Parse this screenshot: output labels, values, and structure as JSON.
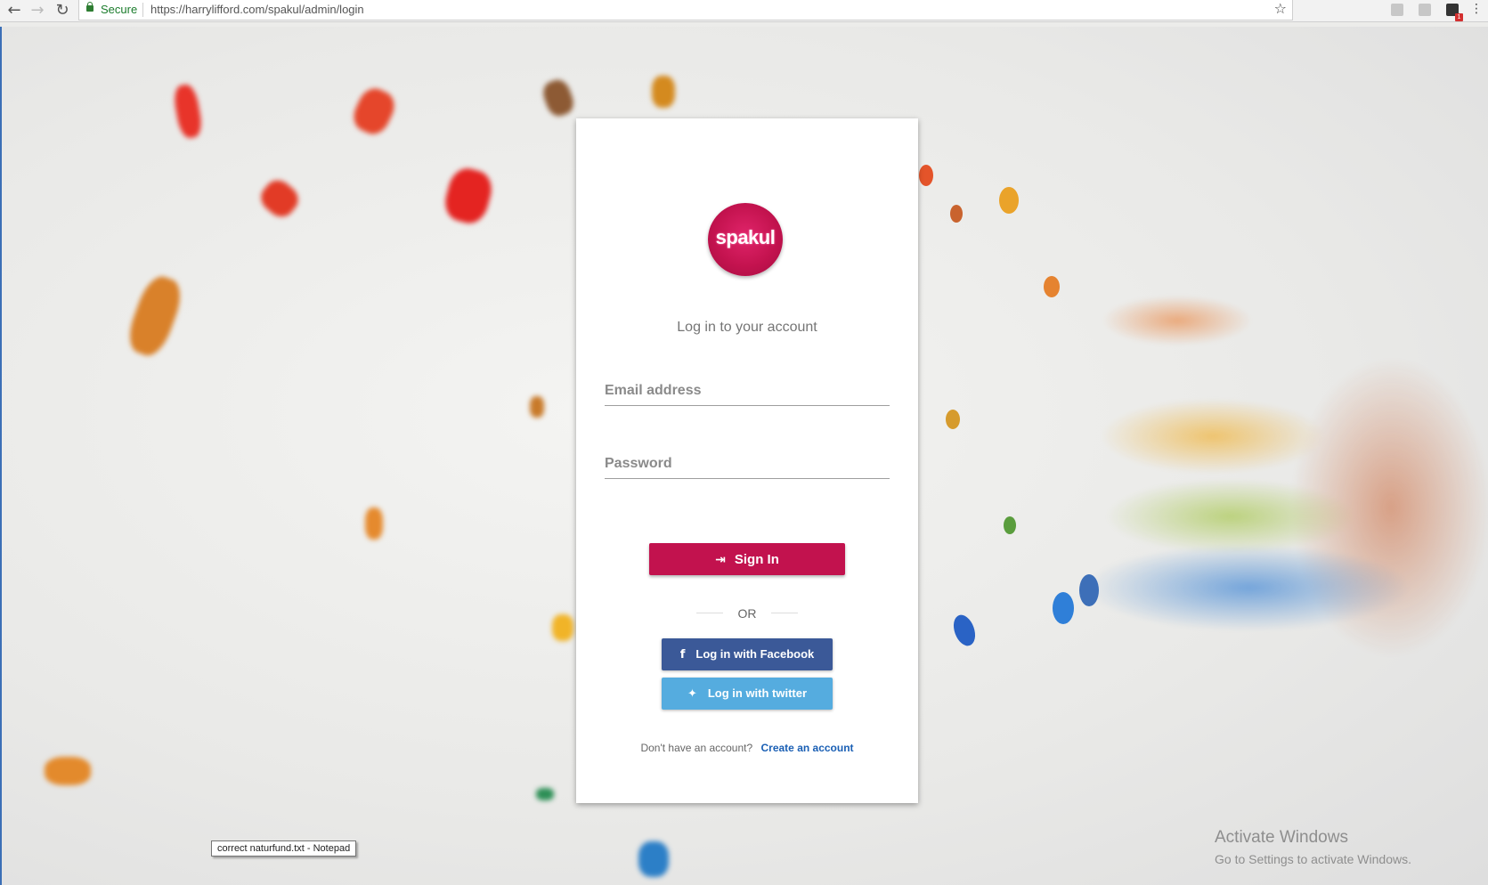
{
  "browser": {
    "secure_label": "Secure",
    "url": "https://harrylifford.com/spakul/admin/login",
    "extension_badge": "1"
  },
  "login": {
    "logo_text": "spakul",
    "subtitle": "Log in to your account",
    "email_placeholder": "Email address",
    "password_placeholder": "Password",
    "signin_label": "Sign In",
    "or_label": "OR",
    "facebook_label": "Log in with Facebook",
    "twitter_label": "Log in with twitter",
    "signup_prompt": "Don't have an account?",
    "signup_link": "Create an account"
  },
  "overlay": {
    "activate_title": "Activate Windows",
    "activate_sub": "Go to Settings to activate Windows.",
    "tooltip": "correct naturfund.txt - Notepad"
  },
  "colors": {
    "brand": "#c2124e",
    "facebook": "#3b5998",
    "twitter": "#55acdf",
    "link": "#1a5fb4"
  }
}
